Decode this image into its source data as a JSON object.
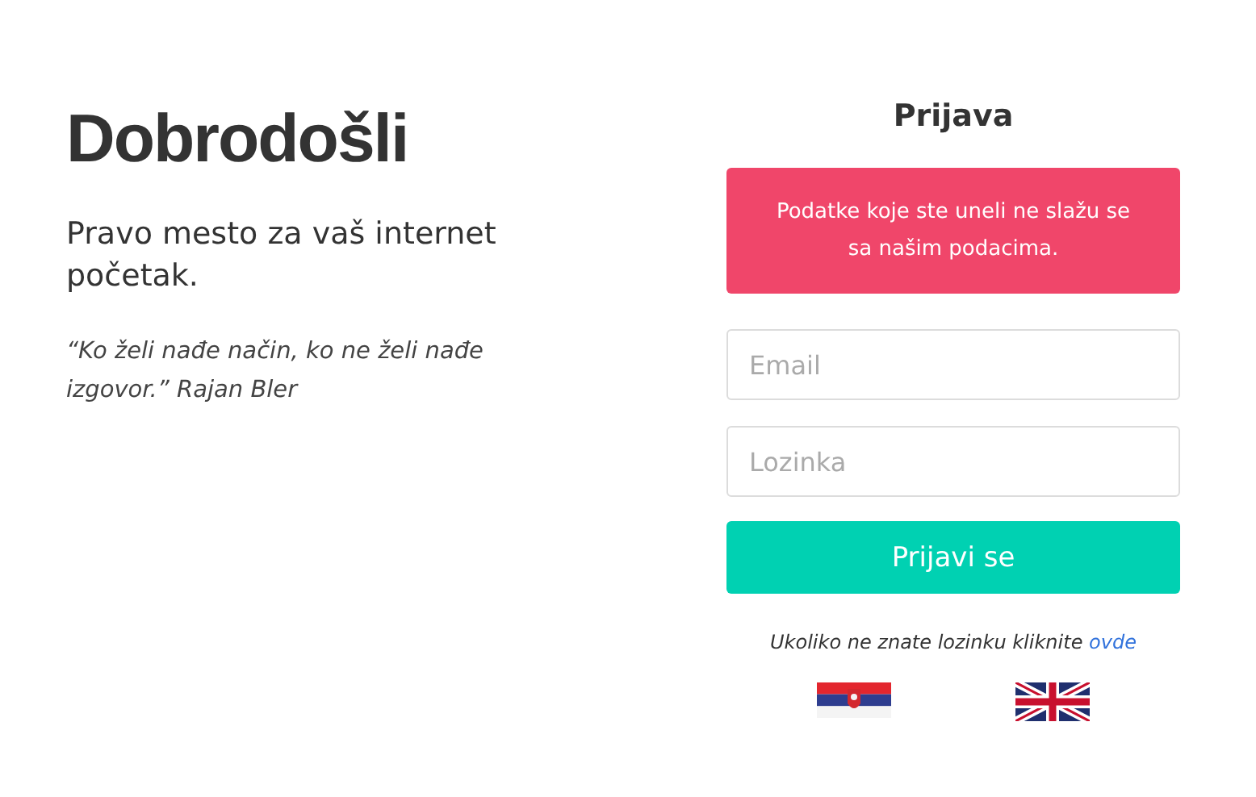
{
  "welcome": {
    "title": "Dobrodošli",
    "subtitle": "Pravo mesto za vaš internet početak.",
    "quote": "“Ko želi nađe način, ko ne želi nađe izgovor.” Rajan Bler"
  },
  "login": {
    "title": "Prijava",
    "error": "Podatke koje ste uneli ne slažu se sa našim podacima.",
    "fields": [
      {
        "placeholder": "Email"
      },
      {
        "placeholder": "Lozinka"
      }
    ],
    "submit": "Prijavi se",
    "forgot_text": "Ukoliko ne znate lozinku kliknite",
    "forgot_link": "ovde"
  }
}
